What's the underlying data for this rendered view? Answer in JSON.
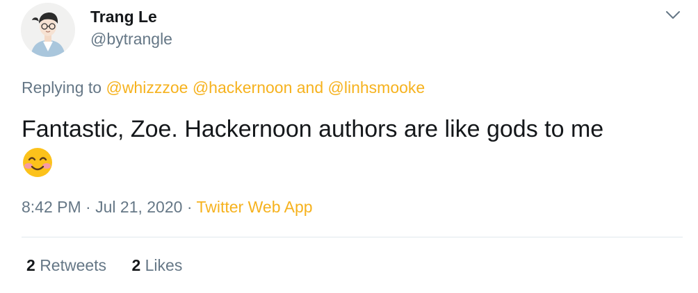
{
  "author": {
    "name": "Trang Le",
    "handle": "@bytrangle",
    "avatar_icon": "avatar-illustration"
  },
  "more_icon": "chevron-down-icon",
  "reply": {
    "prefix": "Replying to",
    "mention_1": "@whizzzoe",
    "mention_2": "@hackernoon",
    "conjunction": "and",
    "mention_3": "@linhsmooke"
  },
  "tweet": {
    "text": "Fantastic, Zoe. Hackernoon authors are like gods to me",
    "emoji": "smiling-face-emoji"
  },
  "meta": {
    "time": "8:42 PM",
    "separator_1": "·",
    "date": "Jul 21, 2020",
    "separator_2": "·",
    "source": "Twitter Web App"
  },
  "stats": {
    "retweets_count": "2",
    "retweets_label": "Retweets",
    "likes_count": "2",
    "likes_label": "Likes"
  },
  "colors": {
    "link": "#f6b21e",
    "secondary_text": "#657786",
    "primary_text": "#14171a",
    "divider": "#e1e8ed"
  }
}
